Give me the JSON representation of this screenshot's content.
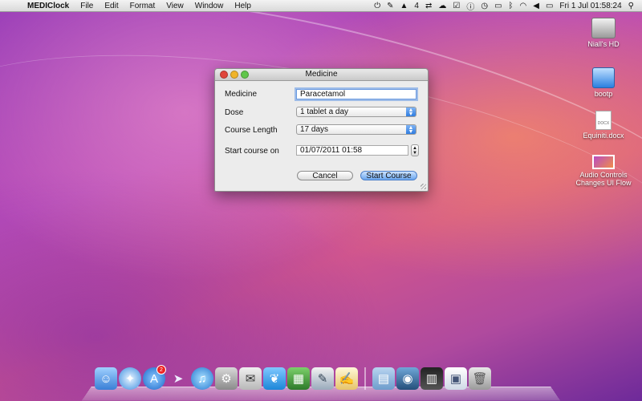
{
  "menubar": {
    "app_name": "MEDIClock",
    "menus": [
      "File",
      "Edit",
      "Format",
      "View",
      "Window",
      "Help"
    ],
    "status": {
      "network_count": "4",
      "datetime": "Fri 1 Jul  01:58:24"
    }
  },
  "window": {
    "title": "Medicine",
    "medicine_label": "Medicine",
    "medicine_value": "Paracetamol",
    "dose_label": "Dose",
    "dose_value": "1 tablet a day",
    "course_label": "Course Length",
    "course_value": "17 days",
    "start_label": "Start course on",
    "start_value": "01/07/2011 01:58",
    "cancel_label": "Cancel",
    "start_button_label": "Start Course"
  },
  "desktop_icons": [
    {
      "label": "Niall's HD",
      "icon": "hard-drive-icon"
    },
    {
      "label": "bootp",
      "icon": "usb-drive-icon"
    },
    {
      "label": "Equiniti.docx",
      "icon": "document-icon",
      "thumb": "DOCX"
    },
    {
      "label": "Audio Controls Changes UI Flow",
      "icon": "screenshot-icon"
    }
  ],
  "dock": {
    "app_store_badge": "2"
  }
}
